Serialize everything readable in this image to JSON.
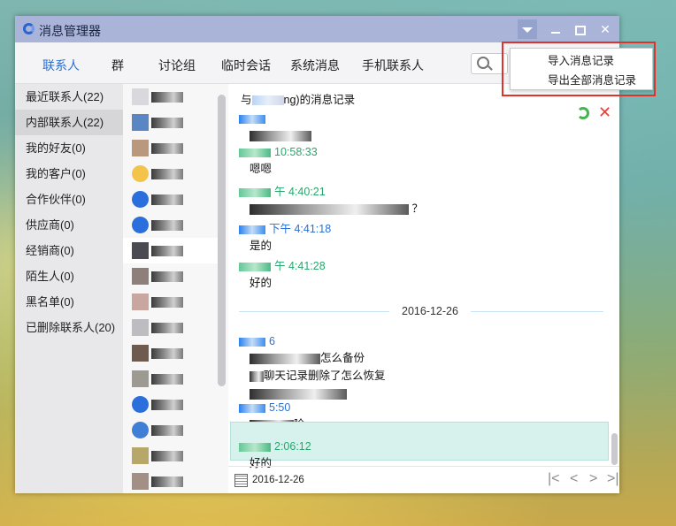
{
  "window": {
    "title": "消息管理器",
    "controls": [
      "dropdown-arrow",
      "minimize",
      "maximize",
      "close"
    ]
  },
  "tabs": [
    {
      "label": "联系人",
      "active": true
    },
    {
      "label": "群"
    },
    {
      "label": "讨论组"
    },
    {
      "label": "临时会话"
    },
    {
      "label": "系统消息"
    },
    {
      "label": "手机联系人"
    }
  ],
  "sidebar": [
    {
      "label": "最近联系人(22)"
    },
    {
      "label": "内部联系人(22)",
      "selected": true
    },
    {
      "label": "我的好友(0)"
    },
    {
      "label": "我的客户(0)"
    },
    {
      "label": "合作伙伴(0)"
    },
    {
      "label": "供应商(0)"
    },
    {
      "label": "经销商(0)"
    },
    {
      "label": "陌生人(0)"
    },
    {
      "label": "黑名单(0)"
    },
    {
      "label": "已删除联系人(20)"
    }
  ],
  "contacts_count": 15,
  "chat": {
    "header_prefix": "与",
    "header_suffix": "ng)的消息记录",
    "messages": [
      {
        "time": "10:58:33",
        "color": "green",
        "text": "嗯嗯"
      },
      {
        "time": "午 4:40:21",
        "color": "green",
        "text": "？"
      },
      {
        "time": "下午 4:41:18",
        "color": "blue",
        "text": "是的"
      },
      {
        "time": "午 4:41:28",
        "color": "green",
        "text": "好的"
      },
      {
        "time": "6",
        "color": "blue",
        "text": "怎么备份"
      },
      {
        "text2": "聊天记录删除了怎么恢复"
      },
      {
        "time": "5:50",
        "color": "blue",
        "text": "睑"
      },
      {
        "time": "2:06:12",
        "color": "green",
        "text": "好的"
      }
    ],
    "date_divider": "2016-12-26",
    "footer_date": "2016-12-26"
  },
  "dropdown_menu": {
    "items": [
      "导入消息记录",
      "导出全部消息记录"
    ]
  },
  "colors": {
    "titlebar": "#a9b4d8",
    "tab_active": "#2a6fd0",
    "highlight": "#e2312a",
    "time_green": "#2aa56e",
    "time_blue": "#2a70d6"
  }
}
